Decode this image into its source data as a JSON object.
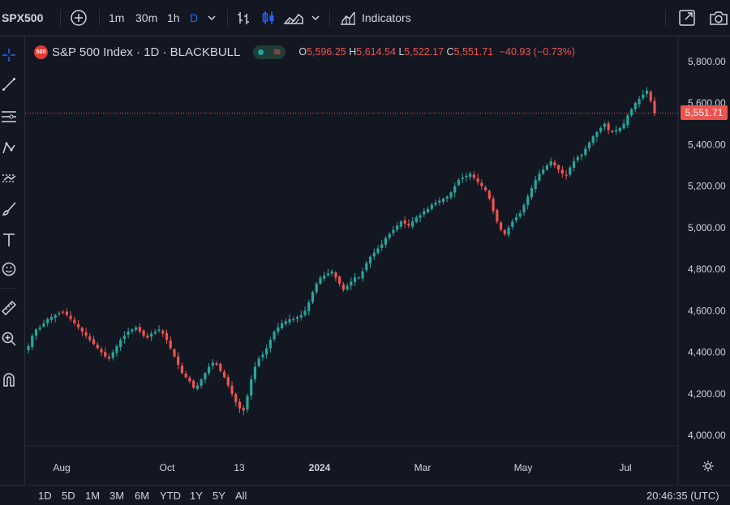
{
  "toolbar": {
    "symbol": "SPX500",
    "intervals": [
      "1m",
      "30m",
      "1h",
      "D"
    ],
    "indicators_label": "Indicators"
  },
  "legend": {
    "badge": "500",
    "title": "S&P 500 Index · 1D · BLACKBULL",
    "o_label": "O",
    "o_value": "5,596.25",
    "h_label": "H",
    "h_value": "5,614.54",
    "l_label": "L",
    "l_value": "5,522.17",
    "c_label": "C",
    "c_value": "5,551.71",
    "change": "−40.93 (−0.73%)"
  },
  "price_axis": {
    "labels": [
      "5,800.00",
      "5,600.00",
      "5,400.00",
      "5,200.00",
      "5,000.00",
      "4,800.00",
      "4,600.00",
      "4,400.00",
      "4,200.00",
      "4,000.00"
    ],
    "last_price_label": "5,551.71"
  },
  "time_axis": {
    "labels": [
      "Aug",
      "Oct",
      "13",
      "2024",
      "Mar",
      "May",
      "Jul"
    ]
  },
  "ranges": [
    "1D",
    "5D",
    "1M",
    "3M",
    "6M",
    "YTD",
    "1Y",
    "5Y",
    "All"
  ],
  "clock": "20:46:35 (UTC)",
  "colors": {
    "up": "#26a69a",
    "down": "#ef5350",
    "background": "#131722",
    "accent": "#2962ff"
  },
  "chart_data": {
    "type": "candlestick",
    "series": [
      {
        "name": "S&P 500 Index",
        "values": [
          4430,
          4480,
          4510,
          4520,
          4540,
          4560,
          4570,
          4580,
          4590,
          4595,
          4580,
          4560,
          4540,
          4520,
          4500,
          4480,
          4460,
          4440,
          4420,
          4400,
          4380,
          4370,
          4400,
          4430,
          4460,
          4480,
          4500,
          4510,
          4520,
          4500,
          4480,
          4470,
          4490,
          4500,
          4510,
          4490,
          4460,
          4420,
          4380,
          4340,
          4300,
          4280,
          4260,
          4230,
          4240,
          4270,
          4300,
          4330,
          4350,
          4340,
          4310,
          4280,
          4240,
          4200,
          4160,
          4130,
          4120,
          4190,
          4270,
          4330,
          4370,
          4390,
          4420,
          4460,
          4500,
          4520,
          4540,
          4550,
          4560,
          4560,
          4570,
          4580,
          4600,
          4640,
          4690,
          4730,
          4760,
          4770,
          4780,
          4790,
          4760,
          4730,
          4700,
          4720,
          4740,
          4760,
          4760,
          4790,
          4830,
          4860,
          4880,
          4900,
          4920,
          4950,
          4970,
          4990,
          5010,
          5030,
          5020,
          5010,
          5030,
          5050,
          5060,
          5080,
          5090,
          5110,
          5120,
          5130,
          5140,
          5150,
          5170,
          5200,
          5230,
          5240,
          5250,
          5260,
          5240,
          5220,
          5200,
          5180,
          5140,
          5080,
          5030,
          4990,
          4970,
          5000,
          5030,
          5050,
          5070,
          5110,
          5150,
          5190,
          5230,
          5260,
          5280,
          5300,
          5320,
          5300,
          5280,
          5260,
          5250,
          5290,
          5320,
          5340,
          5350,
          5380,
          5410,
          5440,
          5460,
          5480,
          5500,
          5470,
          5460,
          5470,
          5480,
          5500,
          5540,
          5570,
          5600,
          5620,
          5640,
          5660,
          5610,
          5551.71
        ]
      }
    ],
    "last_price": 5551.71,
    "ylim": [
      3950,
      5850
    ],
    "y_ticks": [
      4000,
      4200,
      4400,
      4600,
      4800,
      5000,
      5200,
      5400,
      5600,
      5800
    ],
    "x_ticks": [
      "Aug",
      "Oct",
      "13",
      "2024",
      "Mar",
      "May",
      "Jul"
    ],
    "grid": false
  }
}
